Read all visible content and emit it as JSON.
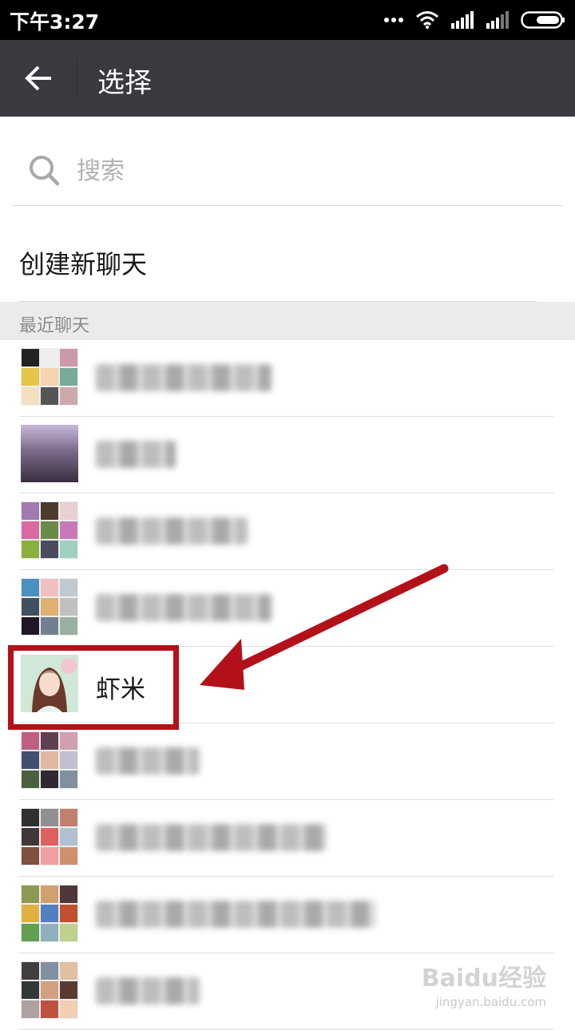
{
  "status_bar": {
    "time": "下午3:27",
    "icons": [
      "more-dots-icon",
      "wifi-icon",
      "signal-icon",
      "signal-icon",
      "battery-icon"
    ]
  },
  "title_bar": {
    "back_icon": "arrow-left-icon",
    "title": "选择"
  },
  "search": {
    "icon": "search-icon",
    "placeholder": "搜索",
    "value": ""
  },
  "create_chat": {
    "label": "创建新聊天"
  },
  "section": {
    "label": "最近聊天"
  },
  "chats": [
    {
      "name": "",
      "blurred": true,
      "avatar": "group",
      "colors": [
        "#222",
        "#eee",
        "#c9a",
        "#e5c44a",
        "#f4d3b0",
        "#7a9",
        "#f1e0c0",
        "#555",
        "#caa"
      ]
    },
    {
      "name": "",
      "blurred": true,
      "avatar": "photo",
      "colors": [
        "#3a2f3f",
        "#7c6a8a",
        "#c8b8d8"
      ]
    },
    {
      "name": "",
      "blurred": true,
      "avatar": "group",
      "colors": [
        "#a07ab0",
        "#4c3b2a",
        "#e8d0d0",
        "#d86aa0",
        "#6a8a4a",
        "#c87ab8",
        "#8ab040",
        "#4a4a60",
        "#a0d0c0"
      ]
    },
    {
      "name": "",
      "blurred": true,
      "avatar": "group",
      "colors": [
        "#4a90c0",
        "#f0c0c0",
        "#c0c8d0",
        "#405060",
        "#e0b070",
        "#c0c0c0",
        "#201828",
        "#708090",
        "#9ab0a0"
      ]
    },
    {
      "name": "虾米",
      "blurred": false,
      "avatar": "portrait",
      "colors": [
        "#f3c6cf",
        "#6a3a2a",
        "#cfe8d8"
      ]
    },
    {
      "name": "",
      "blurred": true,
      "avatar": "group",
      "colors": [
        "#c06080",
        "#604050",
        "#d0a0b0",
        "#405070",
        "#e0b8a0",
        "#c0c0d0",
        "#4a6040",
        "#302830",
        "#8090a0"
      ]
    },
    {
      "name": "",
      "blurred": true,
      "avatar": "group",
      "colors": [
        "#303030",
        "#909090",
        "#c08070",
        "#403838",
        "#e06060",
        "#b0c0d0",
        "#805040",
        "#f0a0a0",
        "#d09070"
      ]
    },
    {
      "name": "",
      "blurred": true,
      "avatar": "group",
      "colors": [
        "#8a9a50",
        "#d0a070",
        "#503838",
        "#e0b040",
        "#5080c0",
        "#c05030",
        "#60a050",
        "#90b0c0",
        "#c0d090"
      ]
    },
    {
      "name": "",
      "blurred": true,
      "avatar": "group",
      "colors": [
        "#404040",
        "#8090a0",
        "#e0c0a0",
        "#303838",
        "#d0a080",
        "#5a3a30",
        "#b0a0a0",
        "#c05040",
        "#f0d0b0"
      ]
    }
  ],
  "annotation": {
    "box_color": "#b3111a",
    "arrow_color": "#b3111a"
  },
  "watermark": {
    "brand": "Baidu经验",
    "url": "jingyan.baidu.com"
  }
}
